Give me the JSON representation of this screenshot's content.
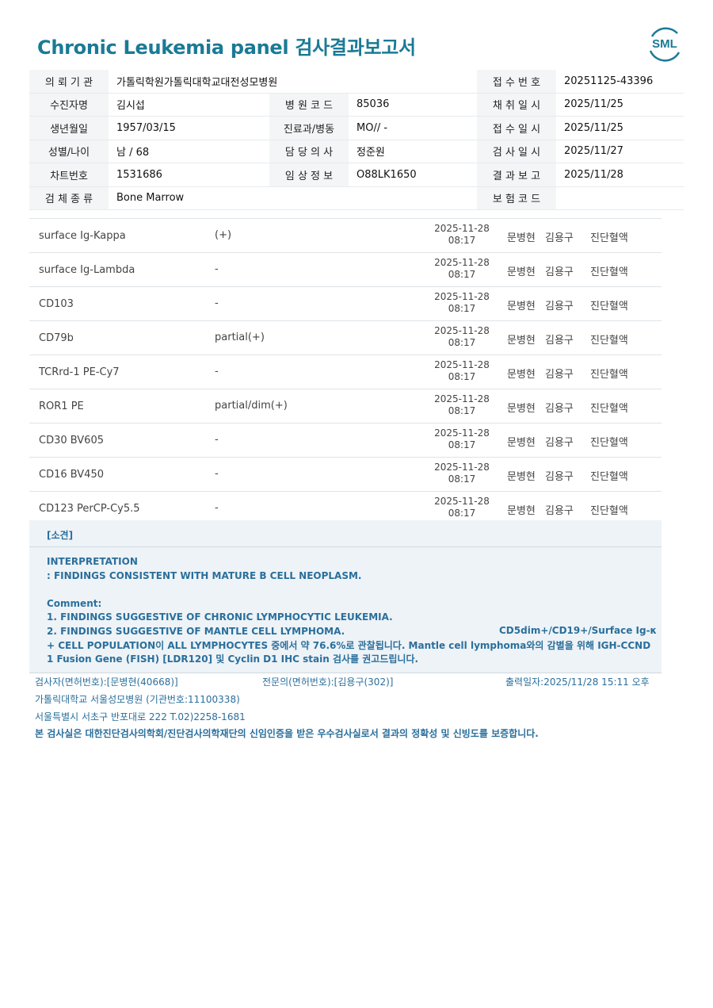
{
  "report": {
    "title": "Chronic Leukemia panel 검사결과보고서",
    "logo_text": "SML"
  },
  "info": {
    "institution_label": "의 뢰 기 관",
    "institution": "가톨릭학원가톨릭대학교대전성모병원",
    "receipt_no_label": "접 수 번 호",
    "receipt_no": "20251125-43396",
    "patient_label": "수진자명",
    "patient": "김시섭",
    "hospital_code_label": "병 원 코 드",
    "hospital_code": "85036",
    "collect_date_label": "채 취 일 시",
    "collect_date": "2025/11/25",
    "dob_label": "생년월일",
    "dob": "1957/03/15",
    "dept_label": "진료과/병동",
    "dept": "MO// -",
    "receive_date_label": "접 수 일 시",
    "receive_date": "2025/11/25",
    "sex_age_label": "성별/나이",
    "sex_age": "남 / 68",
    "doctor_label": "담 당 의 사",
    "doctor": "정준원",
    "test_date_label": "검 사 일 시",
    "test_date": "2025/11/27",
    "chart_label": "차트번호",
    "chart": "1531686",
    "clinical_label": "임 상 정 보",
    "clinical": "O88LK1650",
    "report_date_label": "결 과 보 고",
    "report_date": "2025/11/28",
    "specimen_label": "검 체 종 류",
    "specimen": "Bone Marrow",
    "insurance_label": "보 험 코 드",
    "insurance": ""
  },
  "results": [
    {
      "name": "surface Ig-Kappa",
      "result": "(+)",
      "date": "2025-11-28",
      "time": "08:17",
      "tech": "문병현",
      "doctor": "김용구",
      "dept": "진단혈액"
    },
    {
      "name": "surface Ig-Lambda",
      "result": "-",
      "date": "2025-11-28",
      "time": "08:17",
      "tech": "문병현",
      "doctor": "김용구",
      "dept": "진단혈액"
    },
    {
      "name": "CD103",
      "result": "-",
      "date": "2025-11-28",
      "time": "08:17",
      "tech": "문병현",
      "doctor": "김용구",
      "dept": "진단혈액"
    },
    {
      "name": "CD79b",
      "result": "partial(+)",
      "date": "2025-11-28",
      "time": "08:17",
      "tech": "문병현",
      "doctor": "김용구",
      "dept": "진단혈액"
    },
    {
      "name": "TCRrd-1 PE-Cy7",
      "result": "-",
      "date": "2025-11-28",
      "time": "08:17",
      "tech": "문병현",
      "doctor": "김용구",
      "dept": "진단혈액"
    },
    {
      "name": "ROR1 PE",
      "result": "partial/dim(+)",
      "date": "2025-11-28",
      "time": "08:17",
      "tech": "문병현",
      "doctor": "김용구",
      "dept": "진단혈액"
    },
    {
      "name": "CD30 BV605",
      "result": "-",
      "date": "2025-11-28",
      "time": "08:17",
      "tech": "문병현",
      "doctor": "김용구",
      "dept": "진단혈액"
    },
    {
      "name": "CD16 BV450",
      "result": "-",
      "date": "2025-11-28",
      "time": "08:17",
      "tech": "문병현",
      "doctor": "김용구",
      "dept": "진단혈액"
    },
    {
      "name": "CD123 PerCP-Cy5.5",
      "result": "-",
      "date": "2025-11-28",
      "time": "08:17",
      "tech": "문병현",
      "doctor": "김용구",
      "dept": "진단혈액"
    }
  ],
  "findings": {
    "heading": "[소견]",
    "lines": [
      "INTERPRETATION",
      ": FINDINGS CONSISTENT WITH MATURE B CELL NEOPLASM.",
      "",
      "Comment:",
      "1. FINDINGS SUGGESTIVE OF CHRONIC LYMPHOCYTIC LEUKEMIA.",
      "2. FINDINGS SUGGESTIVE OF MANTLE CELL LYMPHOMA.",
      "+ CELL POPULATION이 ALL LYMPHOCYTES 중에서 약 76.6%로 관찰됩니다. Mantle cell lymphoma와의 감별을 위해 IGH-CCND",
      "1 Fusion Gene (FISH) [LDR120] 및 Cyclin D1 IHC stain 검사를 권고드립니다."
    ],
    "line2_right": "CD5dim+/CD19+/Surface Ig-κ"
  },
  "footer": {
    "tester": "검사자(면허번호):[문병현(40668)]",
    "specialist": "전문의(면허번호):[김용구(302)]",
    "printed": "출력일자:2025/11/28 15:11 오후",
    "institution": "가톨릭대학교 서울성모병원 (기관번호:11100338)",
    "address": "서울특별시 서초구 반포대로 222 T.02)2258-1681",
    "certification": "본 검사실은 대한진단검사의학회/진단검사의학재단의 신임인증을 받은 우수검사실로서 결과의 정확성 및 신빙도를 보증합니다."
  }
}
